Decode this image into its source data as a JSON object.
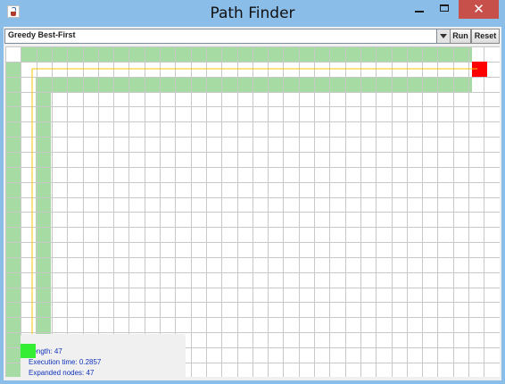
{
  "window": {
    "title": "Path Finder",
    "close_glyph": "✕"
  },
  "toolbar": {
    "algorithm_select": {
      "value": "Greedy Best-First"
    },
    "run_label": "Run",
    "reset_label": "Reset"
  },
  "grid": {
    "columns": 32,
    "rows": 22,
    "colors": {
      "background": "#ffffff",
      "gridline": "#c8c8c8",
      "visited": "#a6dca4",
      "path": "#f5c400",
      "goal": "#ff0000",
      "start": "#33ee33"
    }
  },
  "stats": {
    "length_text": "Length: 47",
    "time_text": "Execution time: 0.2857",
    "expanded_text": "Expanded nodes: 47"
  }
}
